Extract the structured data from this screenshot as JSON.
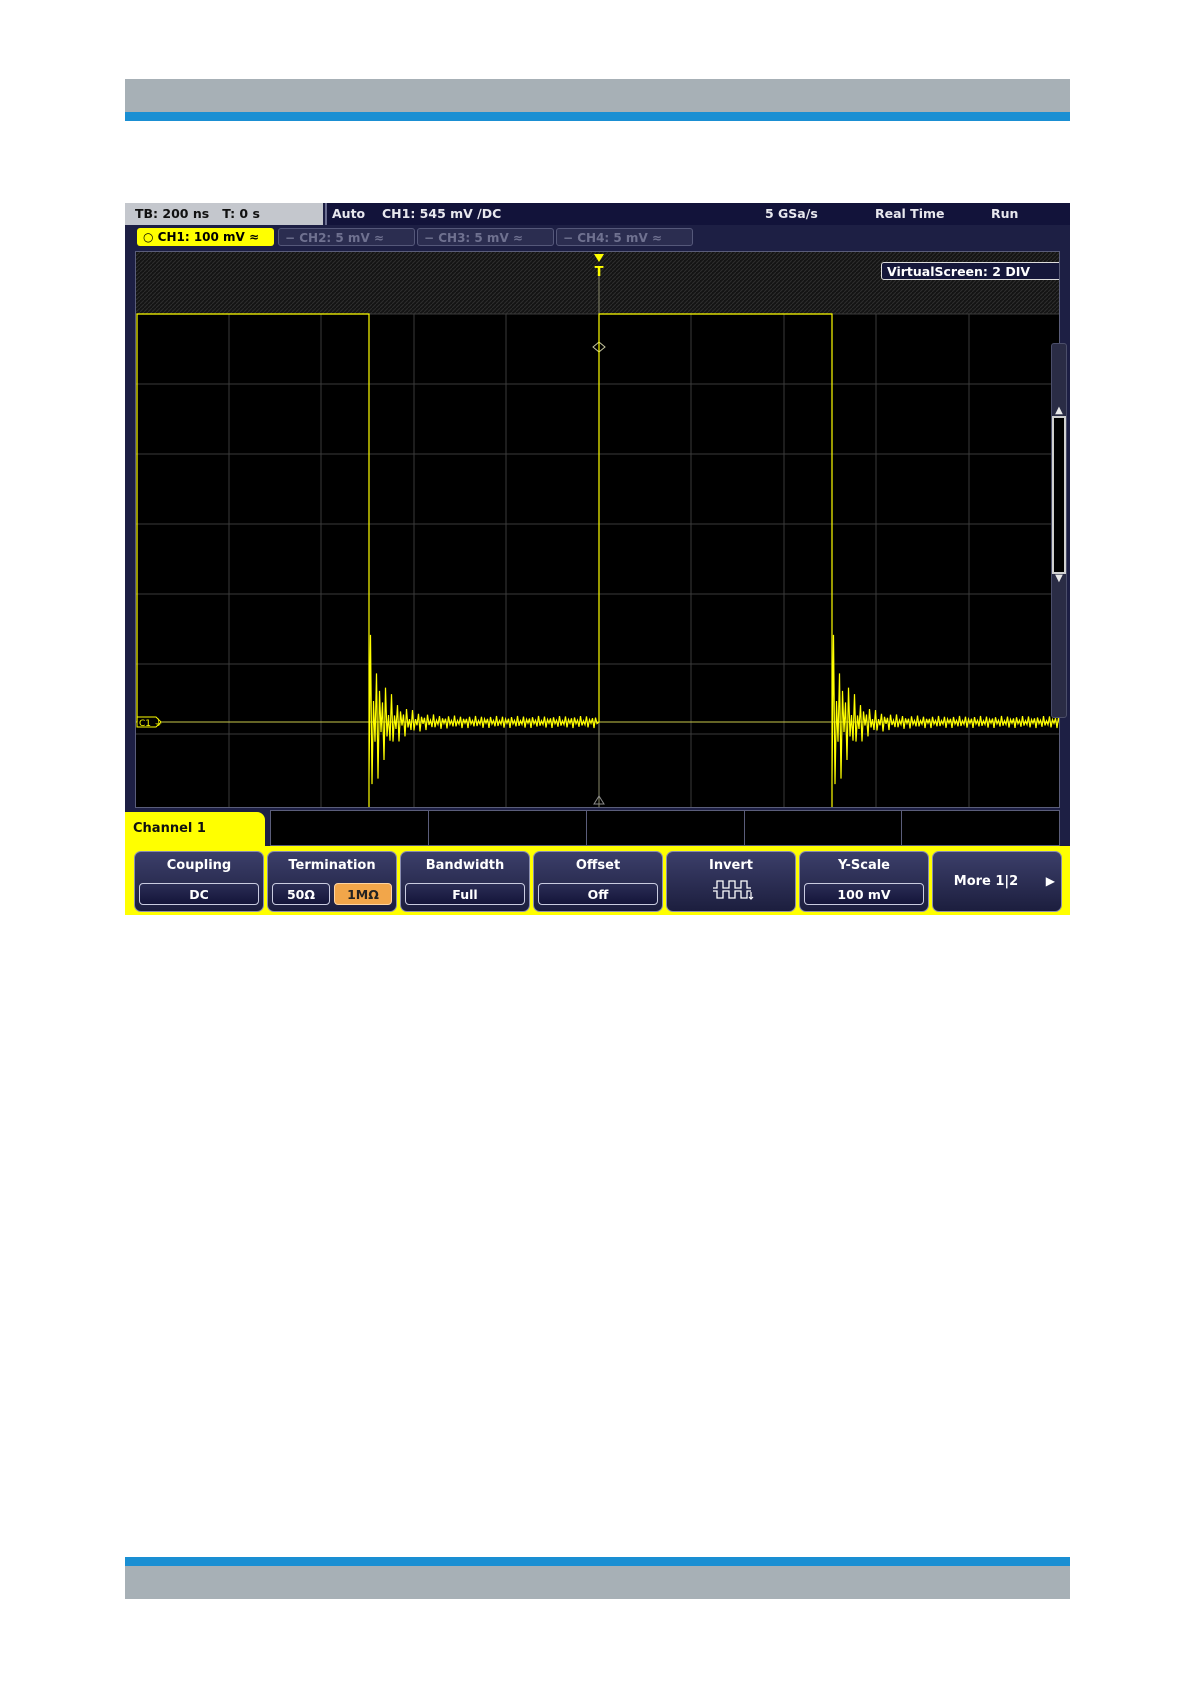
{
  "scope": {
    "timebase": "TB: 200 ns   T: 0 s",
    "trigger_mode": "Auto",
    "trigger_info": "CH1: 545 mV ∕DC",
    "sample_rate": "5 GSa/s",
    "acq_mode": "Real Time",
    "run_state": "Run",
    "channels": [
      {
        "label": "○ CH1: 100 mV ≈",
        "active": true
      },
      {
        "label": "− CH2: 5 mV ≈",
        "active": false
      },
      {
        "label": "− CH3: 5 mV ≈",
        "active": false
      },
      {
        "label": "− CH4: 5 mV ≈",
        "active": false
      }
    ],
    "virtual_screen": "VirtualScreen: 2 DIV",
    "trigger_marker": "T",
    "channel_marker": "C1 ⏚",
    "colors": {
      "trace": "#ffff00",
      "menu_bg": "#ffff00",
      "panel": "#1d1f44"
    }
  },
  "menu": {
    "title": "Channel 1",
    "coupling": {
      "title": "Coupling",
      "value": "DC"
    },
    "termination": {
      "title": "Termination",
      "options": [
        "50Ω",
        "1MΩ"
      ],
      "selected": "1MΩ"
    },
    "bandwidth": {
      "title": "Bandwidth",
      "value": "Full"
    },
    "offset": {
      "title": "Offset",
      "value": "Off"
    },
    "invert": {
      "title": "Invert",
      "icon": "invert-waveform-icon"
    },
    "yscale": {
      "title": "Y-Scale",
      "value": "100 mV"
    },
    "more": {
      "label": "More 1|2",
      "icon": "play-arrow-icon"
    }
  }
}
